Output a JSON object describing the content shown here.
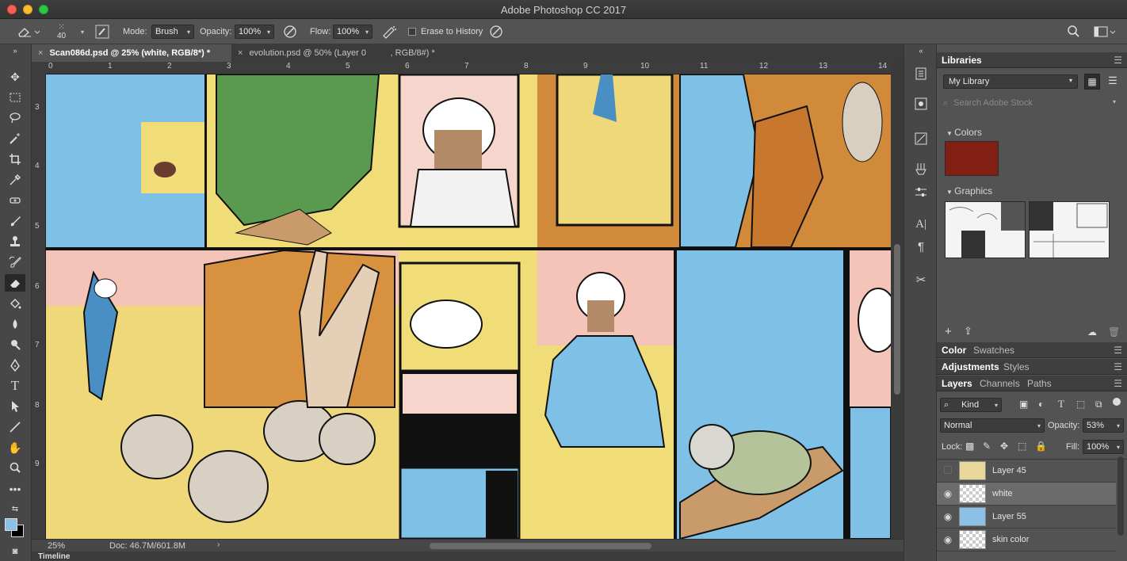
{
  "app": {
    "title": "Adobe Photoshop CC 2017"
  },
  "options_bar": {
    "brush_size": "40",
    "mode_label": "Mode:",
    "mode_value": "Brush",
    "opacity_label": "Opacity:",
    "opacity_value": "100%",
    "flow_label": "Flow:",
    "flow_value": "100%",
    "erase_history_label": "Erase to History",
    "icons": [
      "eraser-icon",
      "brush-preset-icon",
      "brush-panel-icon",
      "pressure-opacity-icon",
      "airbrush-icon",
      "pressure-size-icon",
      "search-icon",
      "workspace-icon"
    ]
  },
  "doc_tabs": [
    {
      "label": "Scan086d.psd @ 25% (white, RGB/8*) *",
      "active": true
    },
    {
      "label": "evolution.psd @ 50% (Layer 0          , RGB/8#) *",
      "active": false
    }
  ],
  "rulers": {
    "top": [
      "0",
      "1",
      "2",
      "3",
      "4",
      "5",
      "6",
      "7",
      "8",
      "9",
      "10",
      "11",
      "12",
      "13",
      "14"
    ],
    "left": [
      "3",
      "4",
      "5",
      "6",
      "7",
      "8",
      "9"
    ]
  },
  "status": {
    "zoom": "25%",
    "doc": "Doc: 46.7M/601.8M"
  },
  "timeline_label": "Timeline",
  "tools": [
    "move-tool-icon",
    "marquee-tool-icon",
    "lasso-tool-icon",
    "magic-wand-icon",
    "crop-tool-icon",
    "eyedropper-icon",
    "healing-brush-icon",
    "brush-tool-icon",
    "clone-stamp-icon",
    "history-brush-icon",
    "eraser-tool-icon",
    "paint-bucket-icon",
    "blur-tool-icon",
    "dodge-tool-icon",
    "pen-tool-icon",
    "type-tool-icon",
    "path-selection-icon",
    "line-tool-icon",
    "hand-tool-icon",
    "zoom-tool-icon",
    "more-tools-icon"
  ],
  "libraries": {
    "tab_label": "Libraries",
    "library_name": "My Library",
    "search_placeholder": "Search Adobe Stock",
    "colors_label": "Colors",
    "color_swatch": "#821f14",
    "graphics_label": "Graphics"
  },
  "color_panel": {
    "tabs": [
      "Color",
      "Swatches"
    ]
  },
  "adjust_panel": {
    "tabs": [
      "Adjustments",
      "Styles"
    ]
  },
  "layers_panel": {
    "tabs": [
      "Layers",
      "Channels",
      "Paths"
    ],
    "kind_label": "Kind",
    "blend_mode": "Normal",
    "opacity_label": "Opacity:",
    "opacity_value": "53%",
    "lock_label": "Lock:",
    "fill_label": "Fill:",
    "fill_value": "100%",
    "layers": [
      {
        "name": "Layer 45",
        "visible": false,
        "selected": false
      },
      {
        "name": "white",
        "visible": true,
        "selected": true
      },
      {
        "name": "Layer 55",
        "visible": true,
        "selected": false
      },
      {
        "name": "skin color",
        "visible": true,
        "selected": false
      }
    ]
  }
}
